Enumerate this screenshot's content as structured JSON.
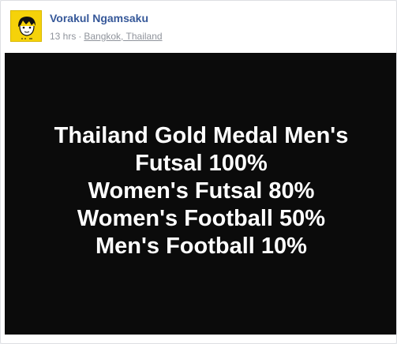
{
  "post": {
    "author": "Vorakul Ngamsaku",
    "time": "13 hrs",
    "separator": "·",
    "location": "Bangkok, Thailand",
    "avatar_icon": "cartoon-face-avatar-icon",
    "accent_color": "#f5d20a"
  },
  "image": {
    "lines": [
      "Thailand Gold Medal Men's",
      "Futsal 100%",
      "Women's Futsal 80%",
      "Women's Football 50%",
      "Men's Football 10%"
    ]
  }
}
